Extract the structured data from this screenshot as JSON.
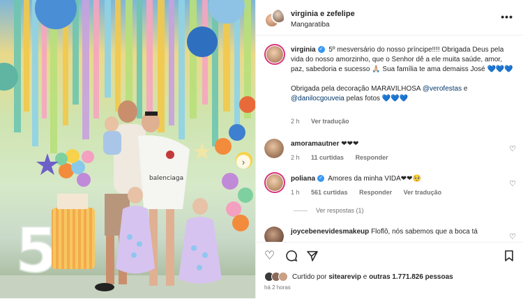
{
  "header": {
    "username": "virginia e zefelipe",
    "location": "Mangaratiba",
    "more_icon": "more-horizontal-icon"
  },
  "caption": {
    "username": "virginia",
    "text": "5º mesversário do nosso príncipe!!!! Obrigada Deus pela vida do nosso amorzinho, que o Senhor dê a ele muita saúde, amor, paz, sabedoria e sucesso 🙏🏼 Sua família te ama demaiss José 💙💙💙",
    "thanks_prefix": "Obrigada pela decoração MARAVILHOSA ",
    "mention1": "@verofestas",
    "thanks_mid": " e ",
    "mention2": "@danilocgouveia",
    "thanks_suffix": " pelas fotos 💙💙💙",
    "time": "2 h",
    "translate": "Ver tradução"
  },
  "comments": [
    {
      "username": "amoramautner",
      "text": "❤❤❤",
      "time": "2 h",
      "likes": "11 curtidas",
      "reply": "Responder"
    },
    {
      "username": "poliana",
      "text": "Amores da minha VIDA❤❤🥺",
      "time": "1 h",
      "likes": "561 curtidas",
      "reply": "Responder",
      "translate": "Ver tradução",
      "verified": true
    },
    {
      "username": "joycebenevidesmakeup",
      "text": "Floflô, nós sabemos que a boca tá"
    }
  ],
  "view_replies": "Ver respostas (1)",
  "actions": {
    "like_icon": "heart-icon",
    "comment_icon": "comment-icon",
    "share_icon": "send-icon",
    "save_icon": "bookmark-icon"
  },
  "likes": {
    "prefix": "Curtido por ",
    "user": "sitearevip",
    "mid": " e ",
    "others": "outras 1.771.826 pessoas"
  },
  "posted_ago": "há 2 horas",
  "colors": {
    "link": "#00376b",
    "verified": "#3897f0",
    "story_ring": "#d8327b"
  }
}
